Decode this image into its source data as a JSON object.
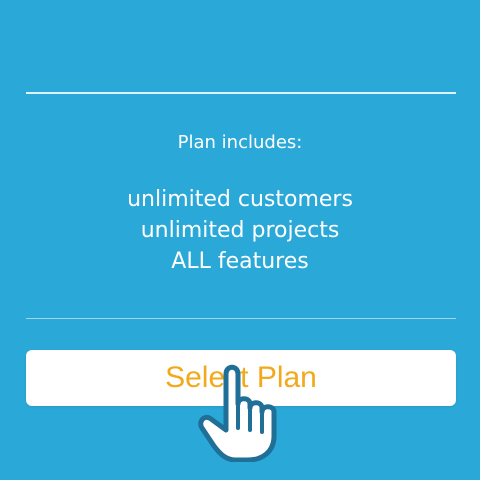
{
  "plan": {
    "includes_title": "Plan includes:",
    "features": [
      "unlimited customers",
      "unlimited projects",
      "ALL features"
    ]
  },
  "actions": {
    "select_plan_label": "Select Plan"
  },
  "colors": {
    "background": "#2aa8d8",
    "button_text": "#f2a91b",
    "cursor_outline": "#1f6f96"
  },
  "icons": {
    "cursor": "hand-pointer-icon"
  }
}
